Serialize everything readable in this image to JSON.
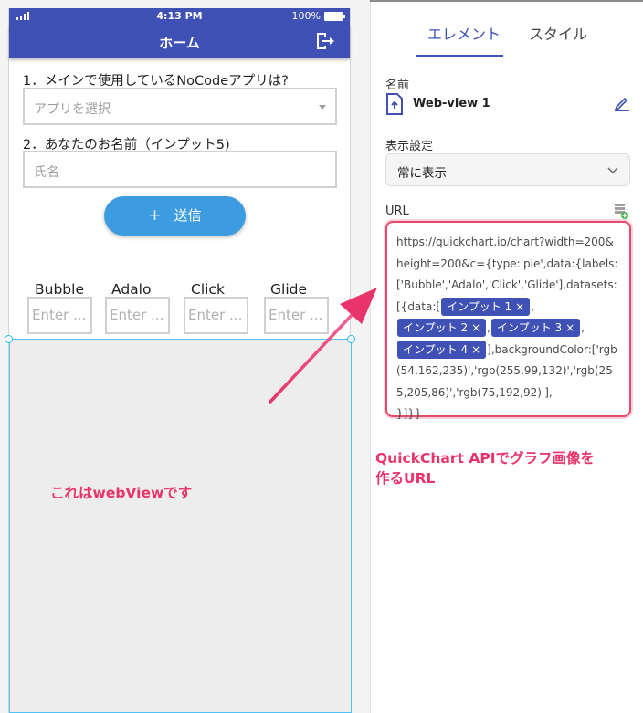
{
  "phone": {
    "status": {
      "time": "4:13 PM",
      "battery": "100%"
    },
    "appbar": {
      "title": "ホーム"
    },
    "form": {
      "q1": "1．メインで使用しているNoCodeアプリは?",
      "q1_placeholder": "アプリを選択",
      "q2": "2．あなたのお名前（インプット5)",
      "q2_placeholder": "氏名",
      "submit_label": "送信",
      "submit_icon": "+"
    },
    "inputs": [
      {
        "label": "Bubble",
        "placeholder": "Enter ..."
      },
      {
        "label": "Adalo",
        "placeholder": "Enter ..."
      },
      {
        "label": "Click",
        "placeholder": "Enter ..."
      },
      {
        "label": "Glide",
        "placeholder": "Enter ..."
      }
    ]
  },
  "panel": {
    "tabs": [
      {
        "label": "エレメント",
        "active": true
      },
      {
        "label": "スタイル",
        "active": false
      }
    ],
    "name_label": "名前",
    "name_value": "Web-view 1",
    "visibility_label": "表示設定",
    "visibility_value": "常に表示",
    "url_label": "URL",
    "url": {
      "part1": "https://quickchart.io/chart?width=200&height=200&c={type:'pie',data:{labels:['Bubble','Adalo','Click','Glide'],datasets:[{data:[",
      "chip1": "インプット 1",
      "sep1": ",",
      "chip2": "インプット 2",
      "sep2": ",",
      "chip3": "インプット 3",
      "sep3": ",",
      "chip4": "インプット 4",
      "part2": "],backgroundColor:['rgb(54,162,235)','rgb(255,99,132)','rgb(255,205,86)','rgb(75,192,92)'],",
      "part3": "}]}}",
      "chip_close": "×"
    }
  },
  "annotations": {
    "webview_note": "これはwebViewです",
    "url_note_line1": "QuickChart APIでグラフ画像を",
    "url_note_line2": "作るURL"
  },
  "colors": {
    "primary": "#3f51b5",
    "accent": "#3d9be0",
    "annotation": "#e8336b"
  }
}
